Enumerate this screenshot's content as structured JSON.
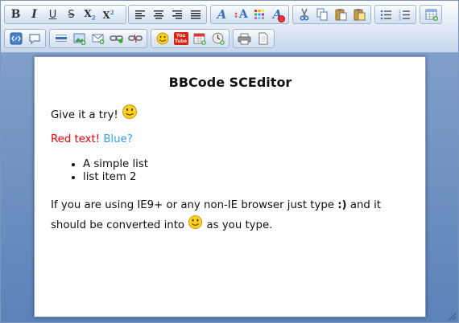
{
  "toolbar": {
    "groups": [
      {
        "name": "text-format",
        "buttons": [
          {
            "label": "B",
            "title": "Bold",
            "icon": "bold-icon"
          },
          {
            "label": "I",
            "title": "Italic",
            "icon": "italic-icon"
          },
          {
            "label": "U",
            "title": "Underline",
            "icon": "underline-icon"
          },
          {
            "label": "S",
            "title": "Strikethrough",
            "icon": "strikethrough-icon"
          },
          {
            "label": "X",
            "title": "Subscript",
            "icon": "subscript-icon"
          },
          {
            "label": "X",
            "title": "Superscript",
            "icon": "superscript-icon"
          }
        ]
      },
      {
        "name": "alignment",
        "buttons": [
          {
            "title": "Align left",
            "icon": "align-left-icon"
          },
          {
            "title": "Center",
            "icon": "align-center-icon"
          },
          {
            "title": "Align right",
            "icon": "align-right-icon"
          },
          {
            "title": "Justify",
            "icon": "justify-icon"
          }
        ]
      },
      {
        "name": "font",
        "buttons": [
          {
            "label": "A",
            "title": "Font Name",
            "icon": "font-name-icon"
          },
          {
            "label": "A",
            "title": "Font Size",
            "icon": "font-size-icon"
          },
          {
            "title": "Font Color",
            "icon": "font-color-icon"
          },
          {
            "label": "A",
            "title": "Remove Formatting",
            "icon": "remove-format-icon"
          }
        ]
      },
      {
        "name": "clipboard",
        "buttons": [
          {
            "title": "Cut",
            "icon": "cut-icon"
          },
          {
            "title": "Copy",
            "icon": "copy-icon"
          },
          {
            "title": "Paste",
            "icon": "paste-icon"
          },
          {
            "title": "Paste your text inside the following box",
            "icon": "paste-text-icon"
          }
        ]
      },
      {
        "name": "lists",
        "buttons": [
          {
            "title": "Bullet list",
            "icon": "bullet-list-icon"
          },
          {
            "title": "Numbered list",
            "icon": "numbered-list-icon"
          }
        ]
      },
      {
        "name": "table",
        "buttons": [
          {
            "title": "Insert a table",
            "icon": "table-icon"
          }
        ]
      },
      {
        "name": "code",
        "buttons": [
          {
            "title": "Code",
            "icon": "code-icon"
          },
          {
            "title": "Insert a Quote",
            "icon": "quote-icon"
          }
        ]
      },
      {
        "name": "insert",
        "buttons": [
          {
            "title": "Insert a horizontal rule",
            "icon": "horizontal-rule-icon"
          },
          {
            "title": "Insert an image",
            "icon": "image-icon"
          },
          {
            "title": "Insert an email",
            "icon": "email-icon"
          },
          {
            "title": "Insert a link",
            "icon": "link-icon"
          },
          {
            "title": "Unlink",
            "icon": "unlink-icon"
          }
        ]
      },
      {
        "name": "media",
        "buttons": [
          {
            "title": "Insert an emoticon",
            "icon": "emoticon-icon"
          },
          {
            "label": "You Tube",
            "title": "Insert a YouTube video",
            "icon": "youtube-icon"
          },
          {
            "title": "Insert current date",
            "icon": "date-icon"
          },
          {
            "title": "Insert current time",
            "icon": "time-icon"
          }
        ]
      },
      {
        "name": "view",
        "buttons": [
          {
            "title": "Print",
            "icon": "print-icon"
          },
          {
            "title": "View source",
            "icon": "source-icon"
          }
        ]
      }
    ]
  },
  "document": {
    "title": "BBCode SCEditor",
    "paragraph1": "Give it a try!",
    "red_text": "Red text!",
    "blue_text": "Blue?",
    "list_items": [
      "A simple list",
      "list item 2"
    ],
    "paragraph3_before_code": "If you are using IE9+ or any non-IE browser just type ",
    "paragraph3_code": ":)",
    "paragraph3_middle": " and it should be converted into ",
    "paragraph3_end": " as you type."
  },
  "colors": {
    "red_text": "#ee0000",
    "blue_text": "#2f9fe0",
    "toolbar_bg": "#dfe8f4",
    "editor_bg": "#7f9fc9"
  }
}
